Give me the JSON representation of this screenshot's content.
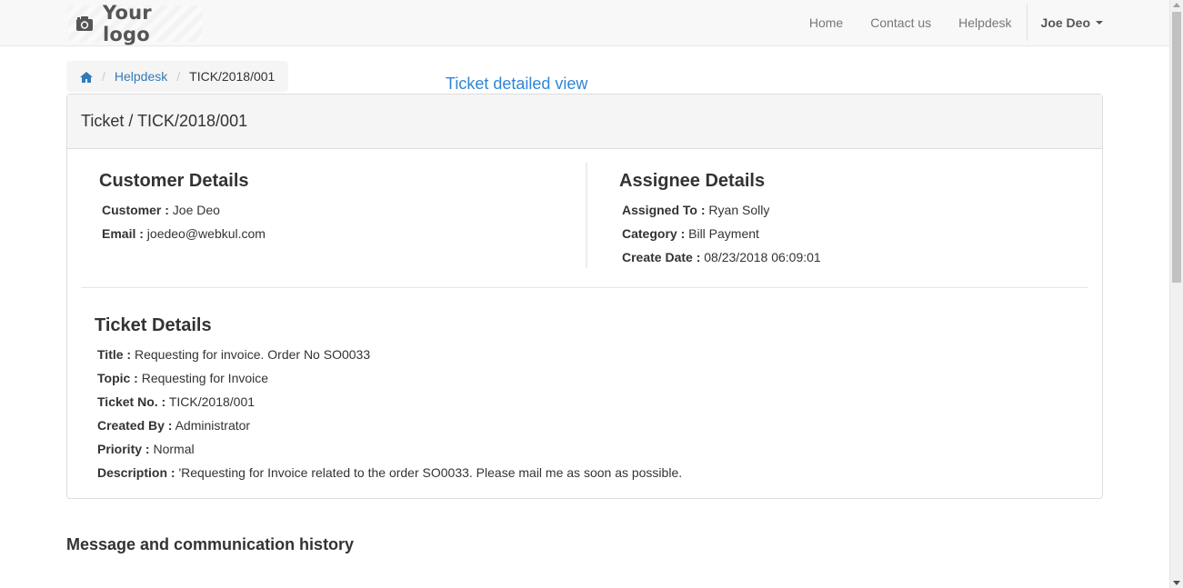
{
  "navbar": {
    "logo_text": "Your logo",
    "links": [
      "Home",
      "Contact us",
      "Helpdesk"
    ],
    "user": "Joe Deo"
  },
  "breadcrumb": {
    "items": [
      "Helpdesk",
      "TICK/2018/001"
    ]
  },
  "page_note": "Ticket detailed view",
  "panel": {
    "heading": "Ticket / TICK/2018/001",
    "customer": {
      "title": "Customer Details",
      "fields": [
        {
          "label": "Customer :",
          "value": "Joe Deo"
        },
        {
          "label": "Email :",
          "value": "joedeo@webkul.com"
        }
      ]
    },
    "assignee": {
      "title": "Assignee Details",
      "fields": [
        {
          "label": "Assigned To :",
          "value": "Ryan Solly"
        },
        {
          "label": "Category :",
          "value": "Bill Payment"
        },
        {
          "label": "Create Date :",
          "value": "08/23/2018 06:09:01"
        }
      ]
    },
    "ticket": {
      "title": "Ticket Details",
      "fields": [
        {
          "label": "Title :",
          "value": "Requesting for invoice. Order No SO0033"
        },
        {
          "label": "Topic :",
          "value": "Requesting for Invoice"
        },
        {
          "label": "Ticket No. :",
          "value": "TICK/2018/001"
        },
        {
          "label": "Created By :",
          "value": "Administrator"
        },
        {
          "label": "Priority :",
          "value": "Normal"
        },
        {
          "label": "Description :",
          "value": "'Requesting for Invoice related to the order SO0033. Please mail me as soon as possible."
        }
      ]
    }
  },
  "history_title": "Message and communication history",
  "icons": {
    "logo": "camera-icon",
    "home": "home-icon",
    "caret": "caret-down-icon"
  },
  "colors": {
    "link": "#337ab7",
    "note": "#2f86d6"
  }
}
